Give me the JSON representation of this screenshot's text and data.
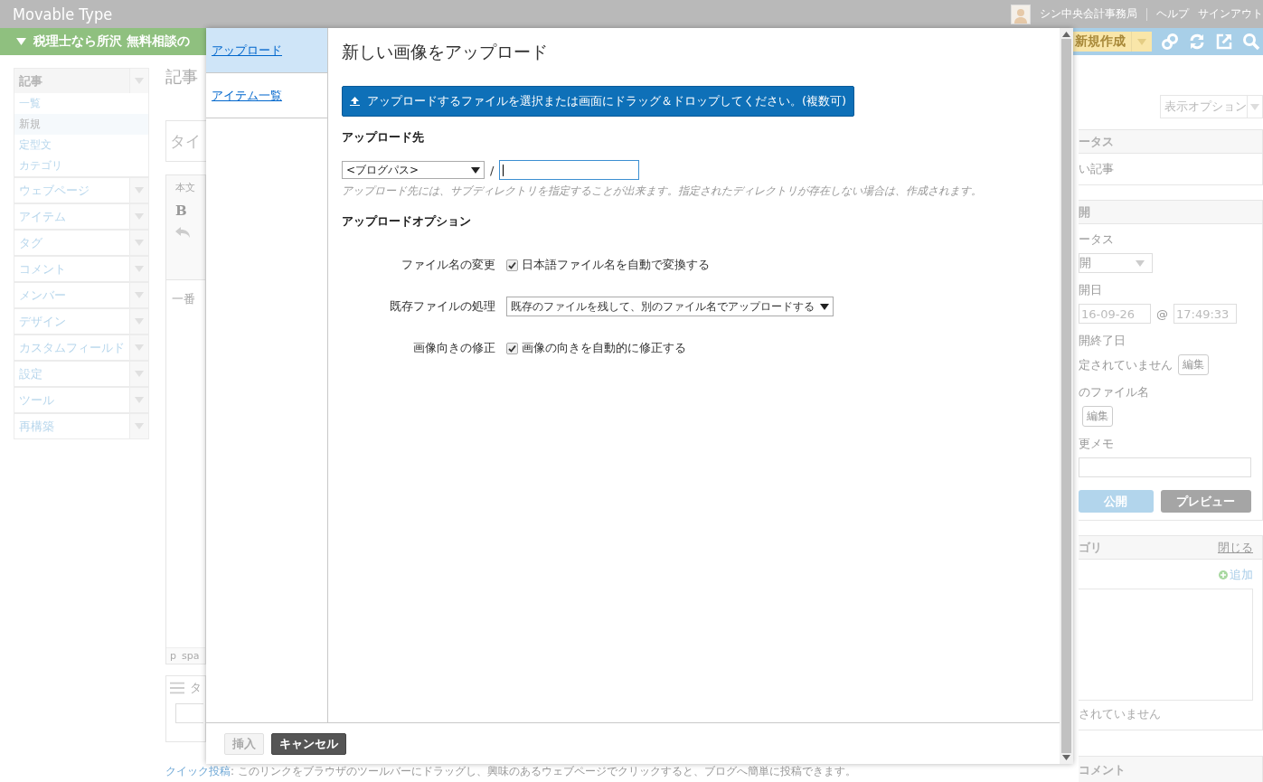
{
  "app": {
    "title": "Movable Type",
    "user": "シン中央会計事務局",
    "links": [
      "ヘルプ",
      "サインアウト"
    ]
  },
  "blog": {
    "name": "税理士なら所沢 無料相談の"
  },
  "toolbar": {
    "new_button": "新規作成"
  },
  "sidebar": [
    {
      "label": "記事",
      "items": [
        {
          "label": "一覧",
          "selected": false
        },
        {
          "label": "新規",
          "selected": true
        },
        {
          "label": "定型文",
          "selected": false
        },
        {
          "label": "カテゴリ",
          "selected": false
        }
      ]
    },
    {
      "label": "ウェブページ"
    },
    {
      "label": "アイテム"
    },
    {
      "label": "タグ"
    },
    {
      "label": "コメント"
    },
    {
      "label": "メンバー"
    },
    {
      "label": "デザイン"
    },
    {
      "label": "カスタムフィールド"
    },
    {
      "label": "設定"
    },
    {
      "label": "ツール"
    },
    {
      "label": "再構築"
    }
  ],
  "editor": {
    "heading": "記事",
    "title_placeholder": "タイ",
    "body_label": "本文",
    "bold": "B",
    "body_text": "一番",
    "path": [
      "p",
      "spa"
    ],
    "tags_label": "タ"
  },
  "quick_post": {
    "link": "クイック投稿",
    "text": ": このリンクをブラウザのツールバーにドラッグし、興味のあるウェブページでクリックすると、ブログへ簡単に投稿できます。"
  },
  "right_panel": {
    "display_options": "表示オプション",
    "status": {
      "heading": "ータス",
      "text": "い記事"
    },
    "publish": {
      "heading": "開",
      "status_label": "ータス",
      "status_value": "開",
      "date_label": "開日",
      "date": "16-09-26",
      "at": "@",
      "time": "17:49:33",
      "end_label": "開終了日",
      "end_value": "定されていません",
      "edit": "編集",
      "filename_label": "のファイル名",
      "filename_edit": "編集",
      "memo_label": "更メモ",
      "publish_button": "公開",
      "preview_button": "プレビュー"
    },
    "category": {
      "heading": "ゴリ",
      "close": "閉じる",
      "add": "追加",
      "footer": "されていません"
    },
    "comments": {
      "heading": "コメント"
    }
  },
  "dialog": {
    "nav": [
      {
        "label": "アップロード",
        "selected": true
      },
      {
        "label": "アイテム一覧",
        "selected": false
      }
    ],
    "title": "新しい画像をアップロード",
    "upload_button": "アップロードするファイルを選択または画面にドラッグ＆ドロップしてください。(複数可)",
    "destination": {
      "heading": "アップロード先",
      "path_select": "<ブログパス>",
      "separator": "/",
      "hint": "アップロード先には、サブディレクトリを指定することが出来ます。指定されたディレクトリが存在しない場合は、作成されます。"
    },
    "options_heading": "アップロードオプション",
    "options": [
      {
        "kind": "checkbox",
        "label": "ファイル名の変更",
        "text": "日本語ファイル名を自動で変換する",
        "checked": true
      },
      {
        "kind": "select",
        "label": "既存ファイルの処理",
        "value": "既存のファイルを残して、別のファイル名でアップロードする"
      },
      {
        "kind": "checkbox",
        "label": "画像向きの修正",
        "text": "画像の向きを自動的に修正する",
        "checked": true
      }
    ],
    "buttons": [
      {
        "label": "挿入",
        "disabled": true
      },
      {
        "label": "キャンセル",
        "disabled": false
      }
    ]
  }
}
